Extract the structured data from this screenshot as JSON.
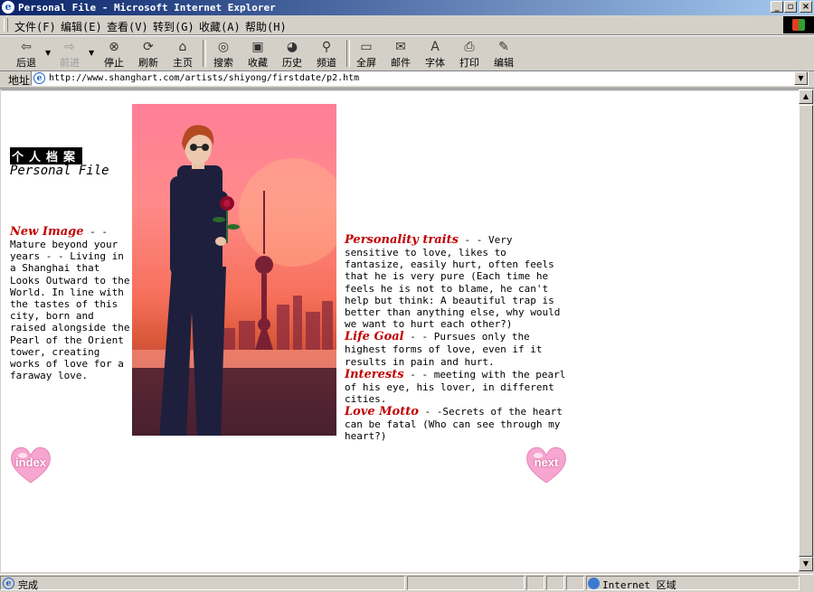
{
  "window": {
    "title": "Personal File - Microsoft Internet Explorer",
    "min_glyph": "_",
    "max_glyph": "▫",
    "close_glyph": "×"
  },
  "menu": [
    {
      "label": "文件(F)"
    },
    {
      "label": "编辑(E)"
    },
    {
      "label": "查看(V)"
    },
    {
      "label": "转到(G)"
    },
    {
      "label": "收藏(A)"
    },
    {
      "label": "帮助(H)"
    }
  ],
  "toolbar": {
    "back": "后退",
    "forward": "前进",
    "stop": "停止",
    "refresh": "刷新",
    "home": "主页",
    "search": "搜索",
    "favorites": "收藏",
    "history": "历史",
    "channels": "频道",
    "fullscreen": "全屏",
    "mail": "邮件",
    "font": "字体",
    "print": "打印",
    "edit": "编辑",
    "icons": {
      "back": "back-arrow-icon",
      "forward": "forward-arrow-icon",
      "stop": "stop-icon",
      "refresh": "refresh-icon",
      "home": "home-icon",
      "search": "search-globe-icon",
      "favorites": "favorites-icon",
      "history": "history-icon",
      "channels": "channels-icon",
      "fullscreen": "fullscreen-icon",
      "mail": "mail-icon",
      "font": "font-icon",
      "print": "printer-icon",
      "edit": "edit-icon"
    }
  },
  "address": {
    "label": "地址",
    "url": "http://www.shanghart.com/artists/shiyong/firstdate/p2.htm"
  },
  "page": {
    "heading_zh": "个人档案",
    "heading_en": "Personal File",
    "new_image": {
      "head": "New Image",
      "body": " - - Mature beyond your years - - Living in a Shanghai that Looks Outward to the World. In line with the tastes of this city, born and raised alongside the Pearl of the Orient tower, creating works of love for a faraway love."
    },
    "traits": [
      {
        "head": "Personality traits",
        "body": " - - Very sensitive to love, likes to fantasize, easily hurt, often feels that he is very pure (Each time he feels he is not to blame, he can't help but think: A beautiful trap is better than anything else, why would we want to hurt each other?)"
      },
      {
        "head": "Life Goal",
        "body": " - - Pursues only the highest forms of love, even if it results in pain and hurt."
      },
      {
        "head": "Interests",
        "body": " - - meeting with the pearl of his eye, his lover, in different cities."
      },
      {
        "head": "Love Motto",
        "body": " - -Secrets of the heart can be fatal (Who can see through my heart?)"
      }
    ],
    "index_label": "index",
    "next_label": "next",
    "colors": {
      "accent_red": "#c00000",
      "heart_pink": "#f6a6cf"
    }
  },
  "status": {
    "text": "完成",
    "zone": "Internet 区域"
  }
}
